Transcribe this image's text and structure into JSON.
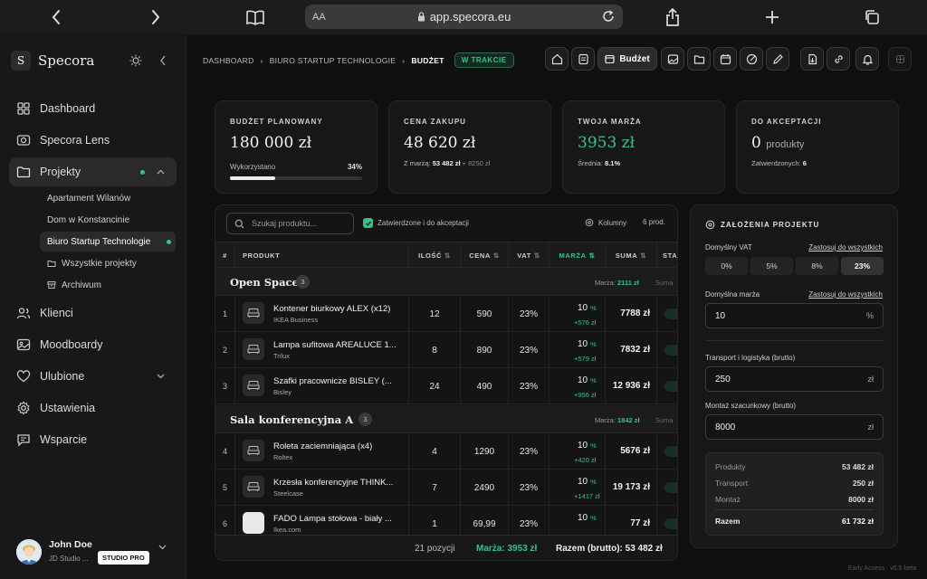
{
  "browser": {
    "url": "app.specora.eu",
    "text_size": "AA"
  },
  "sidebar": {
    "logo_mark": "S",
    "brand": "Specora",
    "nav": [
      {
        "label": "Dashboard"
      },
      {
        "label": "Specora Lens"
      },
      {
        "label": "Projekty"
      },
      {
        "label": "Klienci"
      },
      {
        "label": "Moodboardy"
      },
      {
        "label": "Ulubione"
      },
      {
        "label": "Ustawienia"
      },
      {
        "label": "Wsparcie"
      }
    ],
    "projects": [
      {
        "label": "Apartament Wilanów"
      },
      {
        "label": "Dom w Konstancinie"
      },
      {
        "label": "Biuro Startup Technologie"
      },
      {
        "label": "Wszystkie projekty"
      },
      {
        "label": "Archiwum"
      }
    ],
    "user": {
      "name": "John Doe",
      "studio": "JD Studio ...",
      "plan": "STUDIO PRO"
    }
  },
  "header": {
    "breadcrumbs": [
      "DASHBOARD",
      "BIURO STARTUP TECHNOLOGIE",
      "BUDŻET"
    ],
    "status": "W TRAKCIE",
    "active_tab": "Budżet"
  },
  "stats": {
    "budget": {
      "label": "BUDŻET PLANOWANY",
      "value": "180 000 zł",
      "used_label": "Wykorzystano",
      "used_pct": "34%",
      "used_fraction": 0.34
    },
    "purchase": {
      "label": "CENA ZAKUPU",
      "value": "48 620 zł",
      "sub_prefix": "Z marżą:",
      "sub_value": "53 482 zł",
      "sub_extra": "+ 8250 zł"
    },
    "margin": {
      "label": "TWOJA MARŻA",
      "value": "3953 zł",
      "avg_label": "Średnia:",
      "avg_value": "8.1%"
    },
    "approval": {
      "label": "DO AKCEPTACJI",
      "value": "0",
      "unit": "produkty",
      "approved_label": "Zatwierdzonych:",
      "approved_value": "6"
    }
  },
  "table": {
    "search_placeholder": "Szukaj produktu...",
    "filter_label": "Zatwierdzone i do akceptacji",
    "columns_label": "Kolumny",
    "count_label": "6 prod.",
    "headers": {
      "num": "#",
      "product": "PRODUKT",
      "qty": "ILOŚĆ",
      "price": "CENA",
      "vat": "VAT",
      "margin": "MARŻA",
      "sum": "SUMA",
      "status": "STA"
    },
    "groups": [
      {
        "name": "Open Space",
        "count": "3",
        "margin_label": "Marża:",
        "margin_value": "2111 zł",
        "sum_label": "Suma"
      },
      {
        "name": "Sala konferencyjna A",
        "count": "3",
        "margin_label": "Marża:",
        "margin_value": "1842 zł",
        "sum_label": "Suma"
      }
    ],
    "rows": [
      {
        "n": "1",
        "name": "Kontener biurkowy ALEX (x12)",
        "brand": "IKEA Business",
        "qty": "12",
        "price": "590",
        "vat": "23%",
        "margin": "10",
        "margin_unit": "%",
        "margin_amount": "+576 zł",
        "sum": "7788 zł"
      },
      {
        "n": "2",
        "name": "Lampa sufitowa AREALUCE 1...",
        "brand": "Trilux",
        "qty": "8",
        "price": "890",
        "vat": "23%",
        "margin": "10",
        "margin_unit": "%",
        "margin_amount": "+579 zł",
        "sum": "7832 zł"
      },
      {
        "n": "3",
        "name": "Szafki pracownicze BISLEY (...",
        "brand": "Bisley",
        "qty": "24",
        "price": "490",
        "vat": "23%",
        "margin": "10",
        "margin_unit": "%",
        "margin_amount": "+956 zł",
        "sum": "12 936 zł"
      },
      {
        "n": "4",
        "name": "Roleta zaciemniająca (x4)",
        "brand": "Roltex",
        "qty": "4",
        "price": "1290",
        "vat": "23%",
        "margin": "10",
        "margin_unit": "%",
        "margin_amount": "+420 zł",
        "sum": "5676 zł"
      },
      {
        "n": "5",
        "name": "Krzesła konferencyjne THINK...",
        "brand": "Steelcase",
        "qty": "7",
        "price": "2490",
        "vat": "23%",
        "margin": "10",
        "margin_unit": "%",
        "margin_amount": "+1417 zł",
        "sum": "19 173 zł"
      },
      {
        "n": "6",
        "name": "FADO Lampa stołowa - biały ...",
        "brand": "Ikea.com",
        "qty": "1",
        "price": "69,99",
        "vat": "23%",
        "margin": "10",
        "margin_unit": "%",
        "margin_amount": "",
        "sum": "77 zł"
      }
    ],
    "footer": {
      "positions": "21 pozycji",
      "margin": "Marża: 3953 zł",
      "total": "Razem (brutto): 53 482 zł"
    }
  },
  "assumptions": {
    "title": "ZAŁOŻENIA PROJEKTU",
    "vat_label": "Domyślny VAT",
    "apply_all": "Zastosuj do wszystkich",
    "vat_options": [
      "0%",
      "5%",
      "8%",
      "23%"
    ],
    "vat_selected": "23%",
    "margin_label": "Domyślna marża",
    "margin_value": "10",
    "margin_suffix": "%",
    "transport_label": "Transport i logistyka (brutto)",
    "transport_value": "250",
    "currency": "zł",
    "assembly_label": "Montaż szacunkowy (brutto)",
    "assembly_value": "8000",
    "summary": [
      {
        "label": "Produkty",
        "value": "53 482 zł"
      },
      {
        "label": "Transport",
        "value": "250 zł"
      },
      {
        "label": "Montaż",
        "value": "8000 zł"
      },
      {
        "label": "Razem",
        "value": "61 732 zł"
      }
    ]
  },
  "version": "Early Access · v0.5 beta",
  "colors": {
    "accent": "#36c28a",
    "background": "#101010",
    "panel": "#171717"
  }
}
